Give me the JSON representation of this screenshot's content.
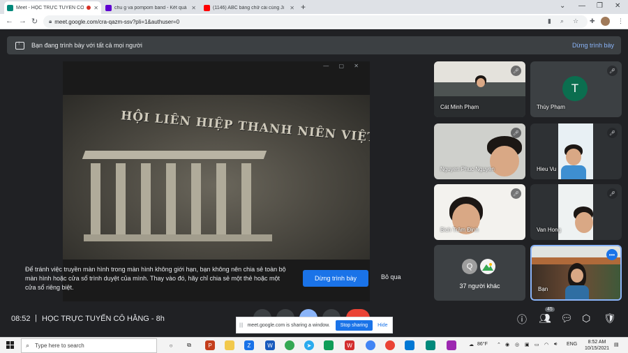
{
  "browser": {
    "tabs": [
      {
        "title": "Meet - HỌC TRỰC TUYẾN CÔ",
        "favicon_color": "#00897b",
        "active": true,
        "recording": true
      },
      {
        "title": "chu g va pompom band - Kết quả",
        "favicon_color": "#5f01d1",
        "active": false,
        "recording": false
      },
      {
        "title": "(1146) ABC bảng chữ cái cùng Ji",
        "favicon_color": "#ff0000",
        "active": false,
        "recording": false
      }
    ],
    "new_tab": "+",
    "url": "meet.google.com/cra-qazm-ssv?pli=1&authuser=0"
  },
  "presenting_bar": {
    "text": "Bạn đang trình bày với tất cả mọi người",
    "stop_label": "Dừng trình bày"
  },
  "presentation": {
    "emblem_text": "HỘI LIÊN HIỆP THANH NIÊN VIỆT NAM"
  },
  "warning": {
    "text": "Để tránh việc truyền màn hình trong màn hình không giới hạn, bạn không nên chia sẻ toàn bộ màn hình hoặc cửa sổ trình duyệt của mình. Thay vào đó, hãy chỉ chia sẻ một thẻ hoặc một cửa sổ riêng biệt.",
    "stop_button": "Dừng trình bày",
    "skip_button": "Bỏ qua"
  },
  "participants": [
    {
      "name": "Cát Minh Phạm",
      "muted": true
    },
    {
      "name": "Thùy Phạm",
      "muted": true,
      "avatar_letter": "T",
      "avatar_color": "#0b6e4f"
    },
    {
      "name": "Nguyen Phuc Nguyen",
      "muted": true
    },
    {
      "name": "Hieu Vu",
      "muted": true
    },
    {
      "name": "Bich Trâm Đinh",
      "muted": true
    },
    {
      "name": "Van Hong",
      "muted": true
    },
    {
      "name": "Bạn",
      "muted": false
    }
  ],
  "others": {
    "label": "37 người khác",
    "avatar_letter": "Q",
    "avatar_color": "#a0a0a0"
  },
  "bottom_bar": {
    "time": "08:52",
    "separator": "|",
    "meeting_title": "HỌC TRỰC TUYẾN CÔ HẰNG - 8h",
    "participant_count": "45"
  },
  "share_bar": {
    "grip": "|||",
    "message": "meet.google.com is sharing a window.",
    "stop_label": "Stop sharing",
    "hide_label": "Hide"
  },
  "taskbar": {
    "search_placeholder": "Type here to search",
    "weather": "86°F",
    "language": "ENG",
    "time": "8:52 AM",
    "date": "10/15/2021"
  }
}
